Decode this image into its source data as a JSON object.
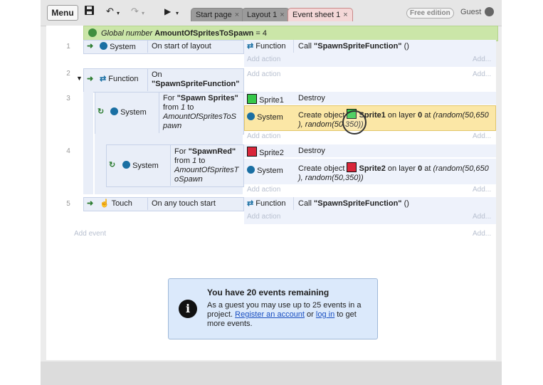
{
  "toolbar": {
    "menu_label": "Menu",
    "tabs": [
      {
        "label": "Start page",
        "close": "×"
      },
      {
        "label": "Layout 1",
        "close": "×"
      },
      {
        "label": "Event sheet 1",
        "close": "×"
      }
    ],
    "edition_badge": "Free edition",
    "guest_label": "Guest"
  },
  "global_var": {
    "prefix": "Global number",
    "name": "AmountOfSpritesToSpawn",
    "value": "= 4"
  },
  "events": {
    "e1": {
      "num": "1",
      "object": "System",
      "condition": "On start of layout",
      "action_object": "Function",
      "action_text_pre": "Call ",
      "action_text_bold": "\"SpawnSpriteFunction\"",
      "action_text_post": " ()"
    },
    "e2": {
      "num": "2",
      "object": "Function",
      "condition_pre": "On",
      "condition_bold": "\"SpawnSpriteFunction\""
    },
    "e3": {
      "num": "3",
      "object": "System",
      "loop_pre": "For ",
      "loop_bold": "\"Spawn Sprites\"",
      "loop_from": "from ",
      "loop_from_val": "1",
      "loop_to": " to",
      "loop_var": "AmountOfSpritesToS pawn",
      "a1_object": "Sprite1",
      "a1_text": "Destroy",
      "a2_object": "System",
      "a2_pre": "Create object ",
      "a2_bold": "Sprite1",
      "a2_mid": " on layer ",
      "a2_layer": "0",
      "a2_at": " at ",
      "a2_args": "(random(50,650 ), random(50,350))"
    },
    "e4": {
      "num": "4",
      "object": "System",
      "loop_pre": "For ",
      "loop_bold": "\"SpawnRed\"",
      "loop_from": "from ",
      "loop_from_val": "1",
      "loop_to": " to",
      "loop_var": "AmountOfSpritesT oSpawn",
      "a1_object": "Sprite2",
      "a1_text": "Destroy",
      "a2_object": "System",
      "a2_pre": "Create object ",
      "a2_bold": "Sprite2",
      "a2_mid": " on layer ",
      "a2_layer": "0",
      "a2_at": " at ",
      "a2_args": "(random(50,650 ), random(50,350))"
    },
    "e5": {
      "num": "5",
      "object": "Touch",
      "condition": "On any touch start",
      "action_object": "Function",
      "action_text_pre": "Call ",
      "action_text_bold": "\"SpawnSpriteFunction\"",
      "action_text_post": " ()"
    }
  },
  "add_action": "Add action",
  "add_short": "Add...",
  "add_event": "Add event",
  "notice": {
    "title": "You have 20 events remaining",
    "line1": "As a guest you may use up to 25 events in a project. ",
    "register": "Register an account",
    "or": " or ",
    "login": "log in",
    "line2": " to get more events."
  },
  "colors": {
    "accent_active_tab": "#f4d7d7",
    "global_bar": "#cbe6a8",
    "notice_bg": "#dbe9fb",
    "highlight": "#fbe7a6"
  }
}
